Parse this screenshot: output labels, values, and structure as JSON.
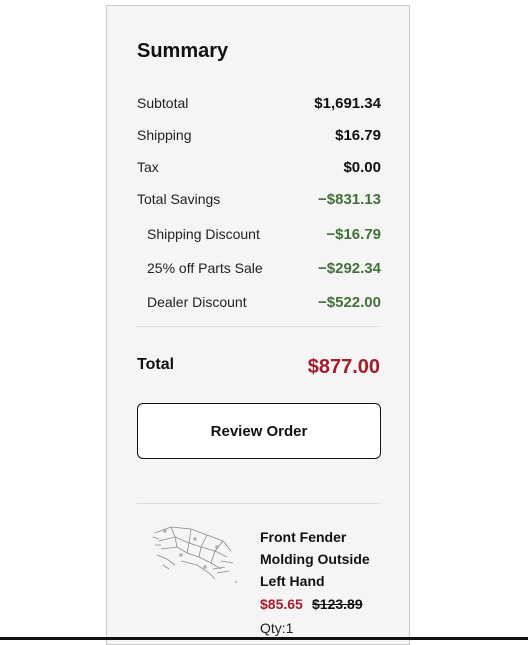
{
  "summary": {
    "title": "Summary",
    "rows": [
      {
        "label": "Subtotal",
        "value": "$1,691.34"
      },
      {
        "label": "Shipping",
        "value": "$16.79"
      },
      {
        "label": "Tax",
        "value": "$0.00"
      },
      {
        "label": "Total Savings",
        "value": "−$831.13"
      }
    ],
    "discounts": [
      {
        "label": "Shipping Discount",
        "value": "−$16.79"
      },
      {
        "label": "25% off Parts Sale",
        "value": "−$292.34"
      },
      {
        "label": "Dealer Discount",
        "value": "−$522.00"
      }
    ],
    "total_label": "Total",
    "total_value": "$877.00",
    "review_button": "Review Order"
  },
  "item": {
    "name": "Front Fender Molding Outside Left Hand",
    "sale_price": "$85.65",
    "original_price": "$123.89",
    "qty": "Qty:1",
    "image_icon": "parts-diagram-thumbnail"
  },
  "colors": {
    "savings_green": "#43703a",
    "total_red": "#a51d2d"
  }
}
